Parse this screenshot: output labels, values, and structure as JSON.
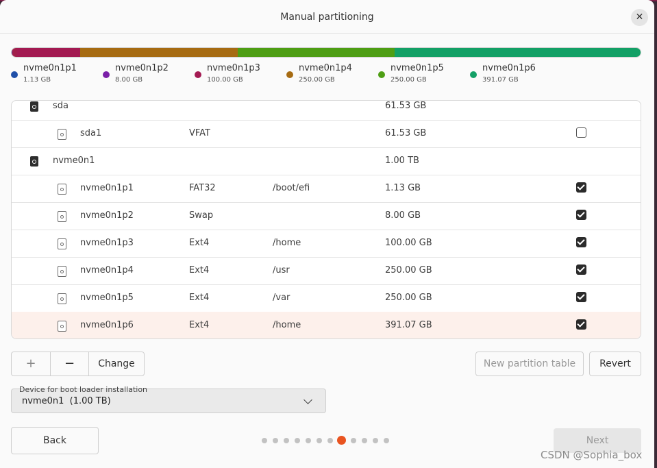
{
  "window": {
    "title": "Manual partitioning"
  },
  "usage_bar": [
    {
      "name": "nvme0n1p1",
      "color": "#5b2b94",
      "flex": 1.13
    },
    {
      "name": "nvme0n1p2",
      "color": "#a11f4b",
      "flex": 8.0
    },
    {
      "name": "nvme0n1p3",
      "color": "#a31a52",
      "flex": 100.0
    },
    {
      "name": "nvme0n1p4",
      "color": "#a66b12",
      "flex": 250.0
    },
    {
      "name": "nvme0n1p5",
      "color": "#4e9e14",
      "flex": 250.0
    },
    {
      "name": "nvme0n1p6",
      "color": "#13a066",
      "flex": 391.07
    }
  ],
  "legend": [
    {
      "name": "nvme0n1p1",
      "size": "1.13 GB",
      "color": "#1f4fa8"
    },
    {
      "name": "nvme0n1p2",
      "size": "8.00 GB",
      "color": "#7a1fa8"
    },
    {
      "name": "nvme0n1p3",
      "size": "100.00 GB",
      "color": "#a31a52"
    },
    {
      "name": "nvme0n1p4",
      "size": "250.00 GB",
      "color": "#a66b12"
    },
    {
      "name": "nvme0n1p5",
      "size": "250.00 GB",
      "color": "#4e9e14"
    },
    {
      "name": "nvme0n1p6",
      "size": "391.07 GB",
      "color": "#13a066"
    }
  ],
  "table": {
    "rows": [
      {
        "device": "sda",
        "type": "disk",
        "filesystem": "",
        "mount": "",
        "size": "61.53 GB"
      },
      {
        "device": "sda1",
        "type": "partition",
        "filesystem": "VFAT",
        "mount": "",
        "size": "61.53 GB",
        "format": false
      },
      {
        "device": "nvme0n1",
        "type": "disk",
        "filesystem": "",
        "mount": "",
        "size": "1.00 TB"
      },
      {
        "device": "nvme0n1p1",
        "type": "partition",
        "filesystem": "FAT32",
        "mount": "/boot/efi",
        "size": "1.13 GB",
        "format": true
      },
      {
        "device": "nvme0n1p2",
        "type": "partition",
        "filesystem": "Swap",
        "mount": "",
        "size": "8.00 GB",
        "format": true
      },
      {
        "device": "nvme0n1p3",
        "type": "partition",
        "filesystem": "Ext4",
        "mount": "/home",
        "size": "100.00 GB",
        "format": true
      },
      {
        "device": "nvme0n1p4",
        "type": "partition",
        "filesystem": "Ext4",
        "mount": "/usr",
        "size": "250.00 GB",
        "format": true
      },
      {
        "device": "nvme0n1p5",
        "type": "partition",
        "filesystem": "Ext4",
        "mount": "/var",
        "size": "250.00 GB",
        "format": true
      },
      {
        "device": "nvme0n1p6",
        "type": "partition",
        "filesystem": "Ext4",
        "mount": "/home",
        "size": "391.07 GB",
        "format": true,
        "selected": true
      }
    ]
  },
  "toolbar": {
    "add_label": "+",
    "remove_label": "−",
    "change_label": "Change",
    "new_table_label": "New partition table",
    "revert_label": "Revert"
  },
  "bootloader": {
    "label": "Device for boot loader installation",
    "value": "nvme0n1  (1.00 TB)"
  },
  "nav": {
    "back_label": "Back",
    "next_label": "Next",
    "step_count": 12,
    "current_step": 8
  },
  "watermark": "CSDN @Sophia_box",
  "accent": "#e95420"
}
